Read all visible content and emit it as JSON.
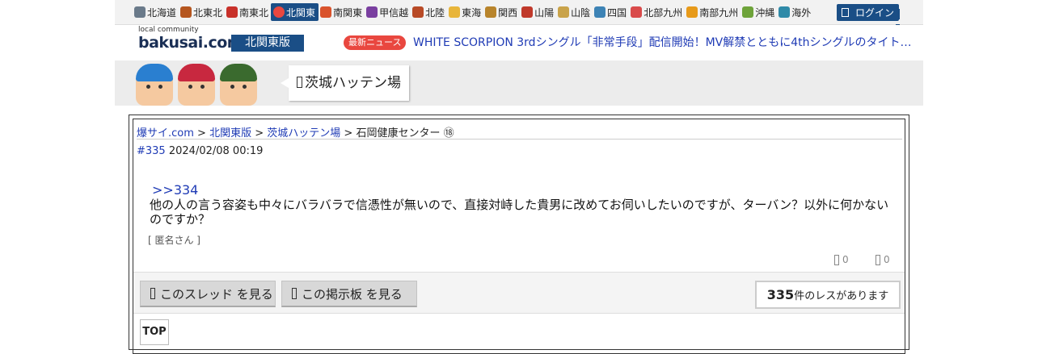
{
  "nav": {
    "regions": [
      {
        "label": "北海道",
        "color": "#6a7a8a"
      },
      {
        "label": "北東北",
        "color": "#b5561f"
      },
      {
        "label": "南東北",
        "color": "#c8312a"
      },
      {
        "label": "北関東",
        "color": "#e9473f",
        "active": true
      },
      {
        "label": "南関東",
        "color": "#d9532c"
      },
      {
        "label": "甲信越",
        "color": "#7a3fa0"
      },
      {
        "label": "北陸",
        "color": "#b84a26"
      },
      {
        "label": "東海",
        "color": "#e8b53a"
      },
      {
        "label": "関西",
        "color": "#b8842b"
      },
      {
        "label": "山陽",
        "color": "#c0392b"
      },
      {
        "label": "山陰",
        "color": "#c9a34a"
      },
      {
        "label": "四国",
        "color": "#3d83b5"
      },
      {
        "label": "北部九州",
        "color": "#d94b4b"
      },
      {
        "label": "南部九州",
        "color": "#e79a1a"
      },
      {
        "label": "沖縄",
        "color": "#6ea33a"
      },
      {
        "label": "海外",
        "color": "#2f8aa8"
      }
    ],
    "login_label": "ログイン"
  },
  "header": {
    "logo_small": "local community",
    "logo_main": "bakusai",
    "logo_tld": ".com",
    "edition": "北関東版",
    "news_badge": "最新ニュース",
    "news_headline": "WHITE SCORPION 3rdシングル「非常手段」配信開始！MV解禁とともに4thシングルのタイトル..."
  },
  "banner": {
    "board_title": "茨城ハッテン場"
  },
  "breadcrumb": {
    "site": "爆サイ.com",
    "sep": " > ",
    "edition": "北関東版",
    "board": "茨城ハッテン場",
    "thread": "石岡健康センター ⑱"
  },
  "post": {
    "number": "#335",
    "datetime": "2024/02/08 00:19",
    "anchor": ">>334",
    "body": "他の人の言う容姿も中々にバラバラで信憑性が無いので、直接対峙した貴男に改めてお伺いしたいのですが、ターバン？以外に何かないのですか？",
    "author": "[ 匿名さん ]",
    "likes": "0",
    "dislikes": "0"
  },
  "actions": {
    "view_thread": "このスレッド を見る",
    "view_board": "この掲示板 を見る",
    "res_count": "335",
    "res_suffix": "件のレスがあります"
  },
  "footer": {
    "top_label": "TOP"
  }
}
